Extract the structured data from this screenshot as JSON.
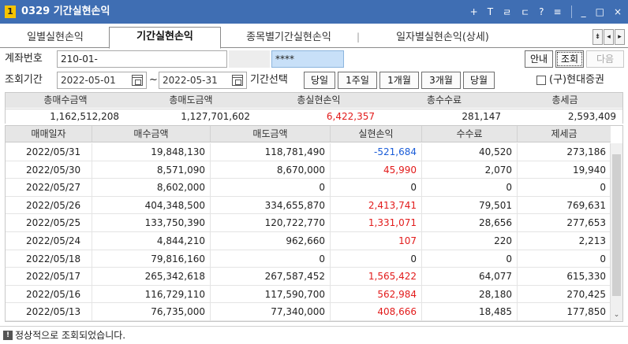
{
  "window": {
    "badge": "1",
    "title": "0329 기간실현손익",
    "controls": [
      "+",
      "T",
      "ㄹ",
      "ㄷ",
      "?",
      "≡",
      "_",
      "□",
      "×"
    ]
  },
  "tabs": [
    {
      "label": "일별실현손익",
      "active": false
    },
    {
      "label": "기간실현손익",
      "active": true
    },
    {
      "label": "종목별기간실현손익",
      "active": false
    },
    {
      "label": "일자별실현손익(상세)",
      "active": false
    }
  ],
  "tab_separator": "|",
  "tab_arrows": [
    "⇟",
    "◂",
    "▸"
  ],
  "account": {
    "label": "계좌번호",
    "number": "210-01-",
    "name": "",
    "password": "****"
  },
  "buttons": {
    "info": "안내",
    "query": "조회",
    "next": "다음"
  },
  "period": {
    "label": "조회기간",
    "start": "2022-05-01",
    "tilde": "~",
    "end": "2022-05-31",
    "select_label": "기간선택",
    "presets": [
      "당일",
      "1주일",
      "1개월",
      "3개월",
      "당월"
    ],
    "old_hyundai_label": "(구)현대증권",
    "old_hyundai_checked": false
  },
  "summary": {
    "headers": [
      "총매수금액",
      "총매도금액",
      "총실현손익",
      "총수수료",
      "총세금"
    ],
    "values": [
      "1,162,512,208",
      "1,127,701,602",
      "6,422,357",
      "281,147",
      "2,593,409"
    ]
  },
  "grid": {
    "headers": [
      "매매일자",
      "매수금액",
      "매도금액",
      "실현손익",
      "수수료",
      "제세금"
    ],
    "rows": [
      [
        "2022/05/31",
        "19,848,130",
        "118,781,490",
        "-521,684",
        "40,520",
        "273,186"
      ],
      [
        "2022/05/30",
        "8,571,090",
        "8,670,000",
        "45,990",
        "2,070",
        "19,940"
      ],
      [
        "2022/05/27",
        "8,602,000",
        "0",
        "0",
        "0",
        "0"
      ],
      [
        "2022/05/26",
        "404,348,500",
        "334,655,870",
        "2,413,741",
        "79,501",
        "769,631"
      ],
      [
        "2022/05/25",
        "133,750,390",
        "120,722,770",
        "1,331,071",
        "28,656",
        "277,653"
      ],
      [
        "2022/05/24",
        "4,844,210",
        "962,660",
        "107",
        "220",
        "2,213"
      ],
      [
        "2022/05/18",
        "79,816,160",
        "0",
        "0",
        "0",
        "0"
      ],
      [
        "2022/05/17",
        "265,342,618",
        "267,587,452",
        "1,565,422",
        "64,077",
        "615,330"
      ],
      [
        "2022/05/16",
        "116,729,110",
        "117,590,700",
        "562,984",
        "28,180",
        "270,425"
      ],
      [
        "2022/05/13",
        "76,735,000",
        "77,340,000",
        "408,666",
        "18,485",
        "177,850"
      ]
    ],
    "scroll_down": "⌄"
  },
  "colors": {
    "titlebar": "#3f6eb3",
    "profit": "#e21b1b",
    "loss": "#1a5cd8"
  },
  "status": {
    "icon": "!",
    "message": "정상적으로 조회되었습니다."
  }
}
